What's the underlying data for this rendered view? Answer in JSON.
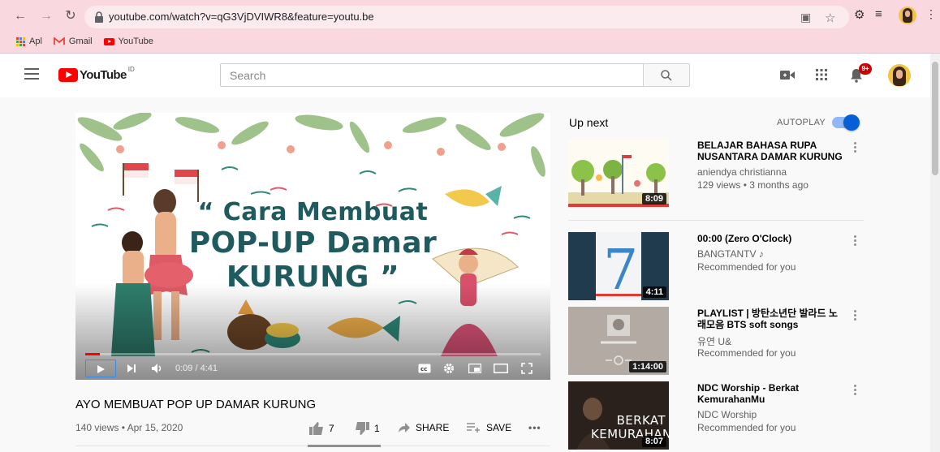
{
  "browser": {
    "url": "youtube.com/watch?v=qG3VjDVIWR8&feature=youtu.be",
    "bookmarks": [
      {
        "label": "Apl"
      },
      {
        "label": "Gmail"
      },
      {
        "label": "YouTube"
      }
    ]
  },
  "masthead": {
    "logo_text": "YouTube",
    "region": "ID",
    "search_placeholder": "Search",
    "notification_count": "9+"
  },
  "player": {
    "title_lines": [
      "“ Cara Membuat",
      "POP-UP Damar",
      "KURUNG ”"
    ],
    "time": "0:09 / 4:41",
    "progress": 0.032
  },
  "video": {
    "title": "AYO MEMBUAT POP UP DAMAR KURUNG",
    "meta": "140 views • Apr 15, 2020",
    "likes": "7",
    "dislikes": "1",
    "share_label": "SHARE",
    "save_label": "SAVE"
  },
  "sidebar": {
    "up_next_label": "Up next",
    "autoplay_label": "AUTOPLAY",
    "autoplay_on": true,
    "items": [
      {
        "title": "BELAJAR BAHASA RUPA NUSANTARA DAMAR KURUNG",
        "channel": "aniendya christianna",
        "sub": "129 views • 3 months ago",
        "duration": "8:09"
      },
      {
        "title": "00:00 (Zero O'Clock)",
        "channel": "BANGTANTV ♪",
        "sub": "Recommended for you",
        "duration": "4:11"
      },
      {
        "title": "PLAYLIST | 방탄소년단 발라드 노래모음 BTS soft songs",
        "channel": "유연 U&",
        "sub": "Recommended for you",
        "duration": "1:14:00"
      },
      {
        "title": "NDC Worship - Berkat KemurahanMu",
        "channel": "NDC Worship",
        "sub": "Recommended for you",
        "duration": "8:07",
        "thumb_text": "BERKAT KEMURAHANMU"
      }
    ]
  },
  "colors": {
    "chrome_bg": "#f9d9df",
    "brand_red": "#ff0000",
    "accent_blue": "#065fd4"
  }
}
